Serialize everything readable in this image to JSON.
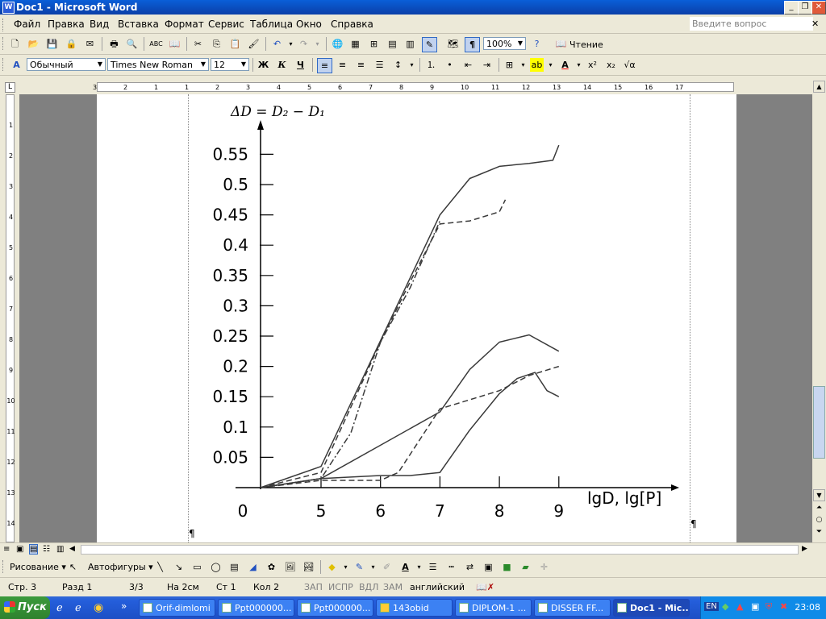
{
  "window": {
    "title": "Doc1 - Microsoft Word",
    "doc_icon_letter": "W"
  },
  "menu": {
    "items": [
      "Файл",
      "Правка",
      "Вид",
      "Вставка",
      "Формат",
      "Сервис",
      "Таблица",
      "Окно",
      "Справка"
    ],
    "ask_placeholder": "Введите вопрос"
  },
  "standard_toolbar": {
    "zoom": "100%",
    "reading_label": "Чтение"
  },
  "format_toolbar": {
    "style": "Обычный",
    "font": "Times New Roman",
    "size": "12",
    "bold": "Ж",
    "italic": "К",
    "underline": "Ч"
  },
  "ruler": {
    "top_numbers": [
      "3",
      "2",
      "1",
      "1",
      "2",
      "3",
      "4",
      "5",
      "6",
      "7",
      "8",
      "9",
      "10",
      "11",
      "12",
      "13",
      "14",
      "15",
      "16",
      "17"
    ],
    "left_numbers": [
      "1",
      "2",
      "3",
      "4",
      "5",
      "6",
      "7",
      "8",
      "9",
      "10",
      "11",
      "12",
      "13",
      "14"
    ]
  },
  "chart_data": {
    "type": "line",
    "title": "ΔD = D₂ − D₁",
    "xlabel": "lgD, lg[P]",
    "ylabel": "",
    "x_ticks": [
      "0",
      "5",
      "6",
      "7",
      "8",
      "9"
    ],
    "y_ticks": [
      "0.05",
      "0.1",
      "0.15",
      "0.2",
      "0.25",
      "0.3",
      "0.35",
      "0.4",
      "0.45",
      "0.5",
      "0.55"
    ],
    "xlim": [
      4.0,
      9.0
    ],
    "ylim": [
      0,
      0.55
    ],
    "series": [
      {
        "style": "solid",
        "x": [
          4.0,
          5.0,
          7.0,
          7.5,
          8.0,
          8.5,
          8.9,
          9.0
        ],
        "y": [
          0.0,
          0.035,
          0.45,
          0.51,
          0.53,
          0.535,
          0.54,
          0.565
        ]
      },
      {
        "style": "dashed",
        "x": [
          4.0,
          5.0,
          6.0,
          6.5,
          7.0,
          7.5,
          8.0,
          8.1
        ],
        "y": [
          0.0,
          0.025,
          0.24,
          0.34,
          0.435,
          0.44,
          0.455,
          0.475
        ]
      },
      {
        "style": "dashdot",
        "x": [
          4.0,
          5.0,
          5.5,
          6.0,
          6.5,
          7.0
        ],
        "y": [
          0.0,
          0.015,
          0.09,
          0.24,
          0.33,
          0.44
        ]
      },
      {
        "style": "solid",
        "x": [
          4.0,
          5.0,
          6.0,
          7.0,
          7.5,
          8.0,
          8.5,
          9.0
        ],
        "y": [
          0.0,
          0.015,
          0.07,
          0.125,
          0.195,
          0.24,
          0.252,
          0.225
        ]
      },
      {
        "style": "dashed",
        "x": [
          4.0,
          5.0,
          6.0,
          6.3,
          6.7,
          7.0,
          7.5,
          8.0,
          8.5,
          9.0
        ],
        "y": [
          0.0,
          0.012,
          0.012,
          0.025,
          0.085,
          0.13,
          0.145,
          0.16,
          0.185,
          0.2
        ]
      },
      {
        "style": "solid",
        "x": [
          4.0,
          5.0,
          6.0,
          6.5,
          7.0,
          7.5,
          8.0,
          8.3,
          8.6,
          8.8,
          9.0
        ],
        "y": [
          0.0,
          0.015,
          0.02,
          0.02,
          0.025,
          0.095,
          0.155,
          0.18,
          0.19,
          0.16,
          0.15
        ]
      }
    ]
  },
  "drawing_toolbar": {
    "draw_label": "Рисование",
    "autoshapes_label": "Автофигуры"
  },
  "status": {
    "page": "Стр. 3",
    "section": "Разд 1",
    "pages": "3/3",
    "at": "На 2см",
    "line": "Ст 1",
    "col": "Кол 2",
    "rec": "ЗАП",
    "trk": "ИСПР",
    "ext": "ВДЛ",
    "ovr": "ЗАМ",
    "lang": "английский"
  },
  "taskbar": {
    "start": "Пуск",
    "tasks": [
      "Orif-dimlomi",
      "Ppt000000...",
      "Ppt000000...",
      "143obid",
      "DIPLOM-1 ...",
      "DISSER FF...",
      "Doc1 - Mic..."
    ],
    "lang": "EN",
    "clock": "23:08"
  }
}
